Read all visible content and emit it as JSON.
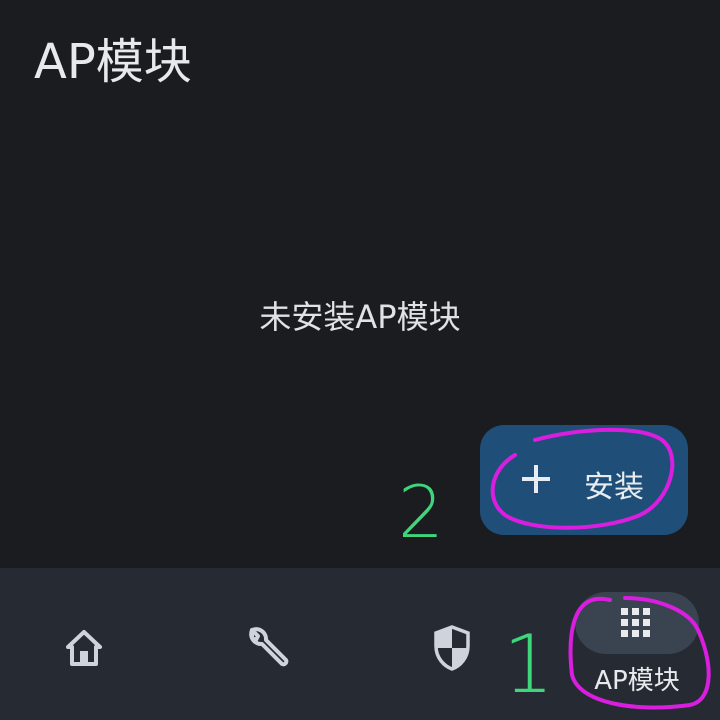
{
  "header": {
    "title": "AP模块"
  },
  "main": {
    "empty_message": "未安装AP模块"
  },
  "fab": {
    "label": "安装",
    "icon": "plus-icon"
  },
  "bottom_nav": {
    "items": [
      {
        "icon": "home-icon",
        "label": ""
      },
      {
        "icon": "wrench-icon",
        "label": ""
      },
      {
        "icon": "shield-icon",
        "label": ""
      },
      {
        "icon": "apps-grid-icon",
        "label": "AP模块",
        "active": true
      }
    ]
  },
  "annotations": {
    "step_1": "1",
    "step_2": "2",
    "marker_color": "#d91ee0",
    "number_color": "#3fd57a"
  },
  "colors": {
    "background": "#1a1c20",
    "nav_background": "#262b33",
    "fab_background": "#1f4f78",
    "active_pill": "#3a4350"
  }
}
